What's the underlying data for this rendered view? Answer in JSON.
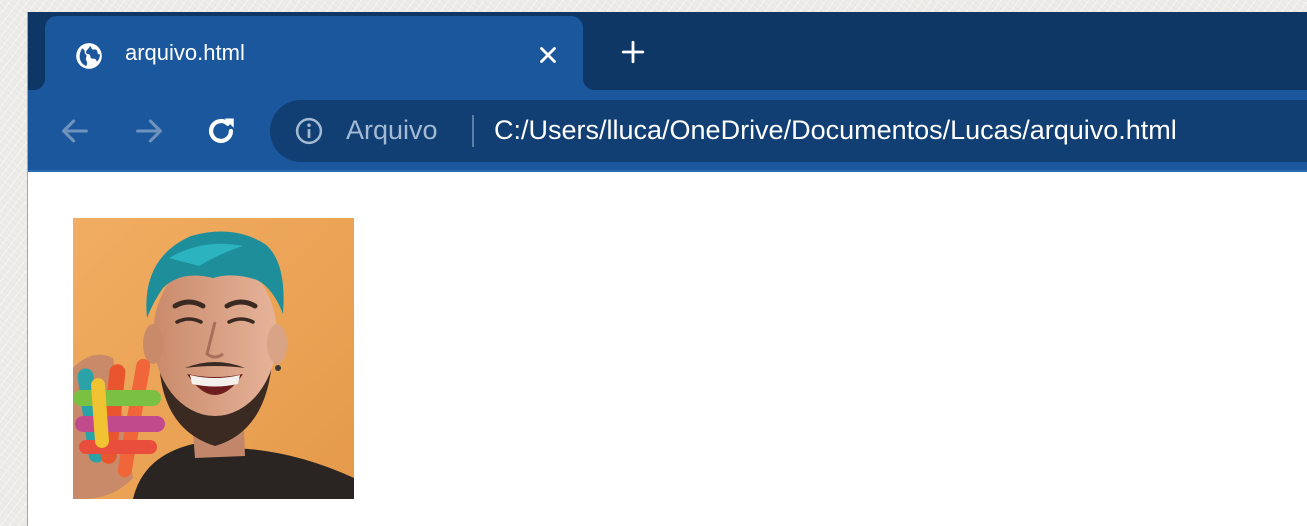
{
  "browser": {
    "tab": {
      "title": "arquivo.html",
      "favicon": "globe-icon",
      "close_icon": "close-icon"
    },
    "new_tab_icon": "plus-icon",
    "toolbar": {
      "back_icon": "arrow-left-icon",
      "forward_icon": "arrow-right-icon",
      "reload_icon": "reload-icon"
    },
    "omnibox": {
      "info_icon": "info-icon",
      "site_chip": "Arquivo",
      "url": "C:/Users/lluca/OneDrive/Documentos/Lucas/arquivo.html"
    }
  },
  "page": {
    "image_description": "Photo of a laughing man with teal hair holding a colorful toy"
  },
  "colors": {
    "tabstrip": "#0e3765",
    "active_tab": "#1a579c",
    "omnibox": "#113e73",
    "page_background": "#ffffff",
    "photo_background": "#eda458"
  }
}
